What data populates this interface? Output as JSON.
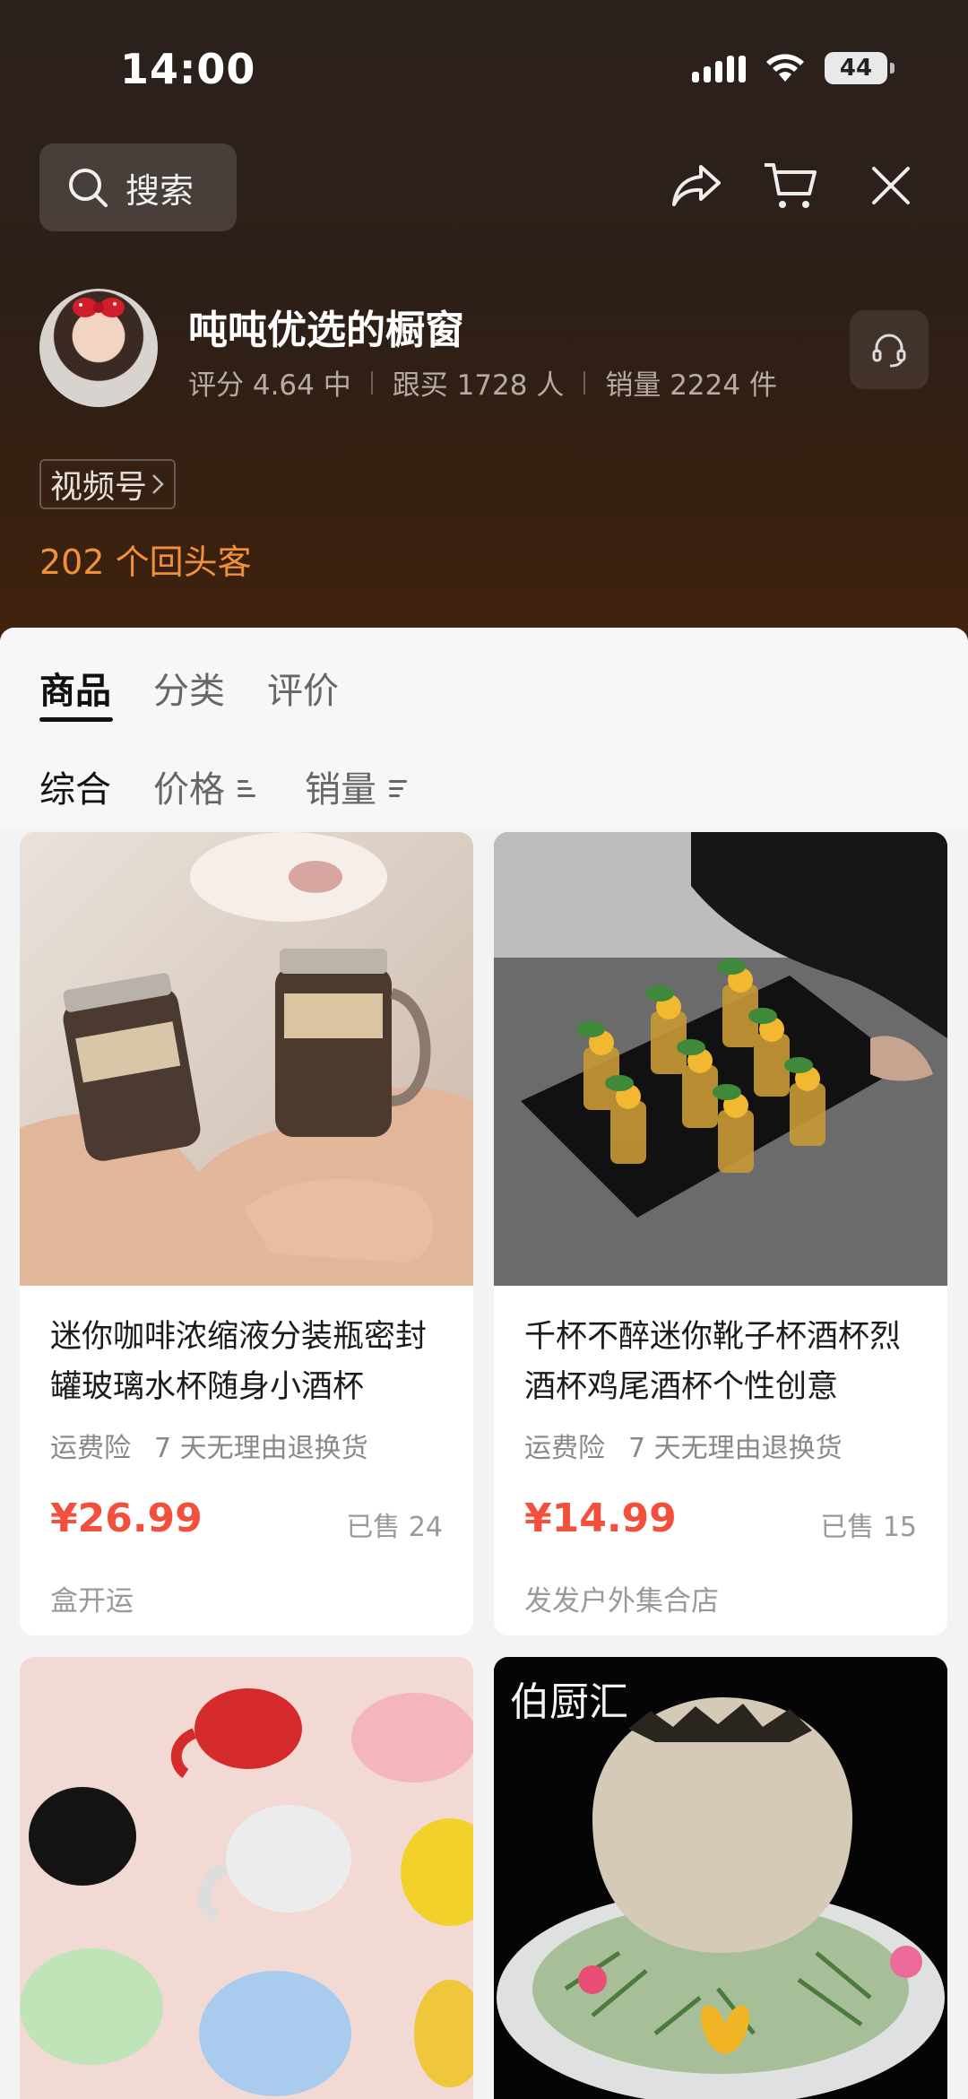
{
  "status": {
    "time": "14:00",
    "battery": "44"
  },
  "nav": {
    "search_label": "搜索"
  },
  "store": {
    "name": "吨吨优选的橱窗",
    "rating": "评分 4.64 中",
    "followers": "跟买 1728 人",
    "sales": "销量 2224 件",
    "channel_tag": "视频号",
    "returning_customers": "202 个回头客"
  },
  "tabs": [
    {
      "label": "商品",
      "active": true
    },
    {
      "label": "分类",
      "active": false
    },
    {
      "label": "评价",
      "active": false
    }
  ],
  "sort": [
    {
      "label": "综合"
    },
    {
      "label": "价格"
    },
    {
      "label": "销量"
    }
  ],
  "products": [
    {
      "title": "迷你咖啡浓缩液分装瓶密封罐玻璃水杯随身小酒杯",
      "tag1": "运费险",
      "tag2": "7 天无理由退换货",
      "price": "¥26.99",
      "sold": "已售 24",
      "shop": "盒开运"
    },
    {
      "title": "千杯不醉迷你靴子杯酒杯烈酒杯鸡尾酒杯个性创意",
      "tag1": "运费险",
      "tag2": "7 天无理由退换货",
      "price": "¥14.99",
      "sold": "已售 15",
      "shop": "发发户外集合店"
    },
    {
      "image_text": ""
    },
    {
      "image_text": "伯厨汇"
    }
  ],
  "colors": {
    "accent_price": "#f2503c",
    "returning_orange": "#f0913a"
  }
}
